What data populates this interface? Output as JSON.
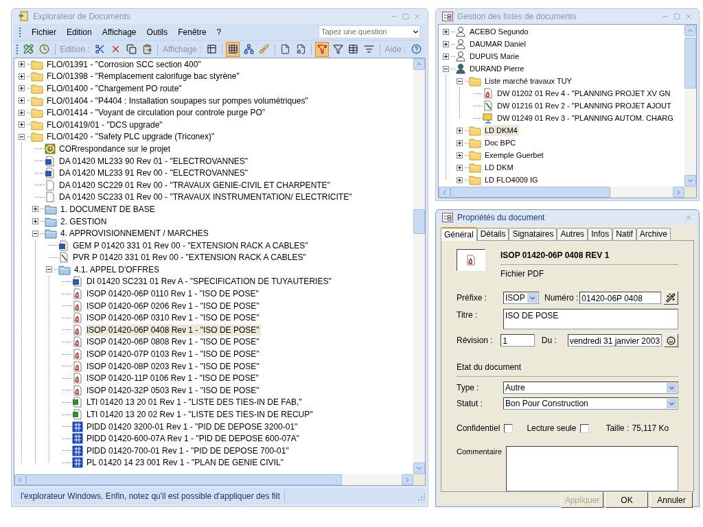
{
  "explorer": {
    "title": "Explorateur de Documents",
    "active": false,
    "menu": [
      {
        "label": "Fichier"
      },
      {
        "label": "Edition"
      },
      {
        "label": "Affichage"
      },
      {
        "label": "Outils"
      },
      {
        "label": "Fenêtre"
      },
      {
        "label": "?"
      }
    ],
    "search": {
      "placeholder": "Tapez une question"
    },
    "toolbar": [
      {
        "kind": "button",
        "pressed": false
      },
      {
        "kind": "button",
        "pressed": false
      },
      {
        "kind": "separator"
      },
      {
        "kind": "label",
        "text": "Edition :"
      },
      {
        "kind": "button",
        "pressed": false
      },
      {
        "kind": "button",
        "pressed": false
      },
      {
        "kind": "button",
        "pressed": false
      },
      {
        "kind": "button",
        "pressed": false
      },
      {
        "kind": "separator"
      },
      {
        "kind": "label",
        "text": "Affichage :"
      },
      {
        "kind": "button",
        "pressed": false
      },
      {
        "kind": "separator"
      },
      {
        "kind": "button",
        "pressed": true
      },
      {
        "kind": "button",
        "pressed": false
      },
      {
        "kind": "button",
        "pressed": false
      },
      {
        "kind": "separator"
      },
      {
        "kind": "button",
        "pressed": false
      },
      {
        "kind": "button",
        "pressed": false
      },
      {
        "kind": "separator"
      },
      {
        "kind": "button",
        "pressed": true
      },
      {
        "kind": "button",
        "pressed": false
      },
      {
        "kind": "button",
        "pressed": false
      },
      {
        "kind": "button",
        "pressed": false
      },
      {
        "kind": "separator"
      },
      {
        "kind": "label",
        "text": "Aide :"
      },
      {
        "kind": "button",
        "pressed": false
      }
    ],
    "tree": [
      {
        "label": "FLO/01391 - \"Corrosion SCC section 400\"",
        "kind": "folder",
        "expanded": false,
        "selected": false
      },
      {
        "label": "FLO/01398 - \"Remplacement calorifuge bac styrène\"",
        "kind": "folder",
        "expanded": false,
        "selected": false
      },
      {
        "label": "FLO/01400 - \"Chargement PO route\"",
        "kind": "folder",
        "expanded": false,
        "selected": false
      },
      {
        "label": "FLO/01404 - \"P4404 : Installation soupapes sur pompes volumétriques\"",
        "kind": "folder",
        "expanded": false,
        "selected": false
      },
      {
        "label": "FLO/01414 - \"Voyant de circulation pour controle purge PO\"",
        "kind": "folder",
        "expanded": false,
        "selected": false
      },
      {
        "label": "FLO/01419/01 - \"DCS upgrade\"",
        "kind": "folder",
        "expanded": false,
        "selected": false
      },
      {
        "label": "FLO/01420 - \"Safety PLC upgrade (Triconex)\"",
        "kind": "folder",
        "expanded": true,
        "selected": false,
        "children": [
          {
            "label": "CORrespondance sur le projet",
            "kind": "cor",
            "selected": false
          },
          {
            "label": "DA 01420 ML233 90 Rev 01 - \"ELECTROVANNES\"",
            "kind": "word",
            "selected": false
          },
          {
            "label": "DA 01420 ML233 91 Rev 00 - \"ELECTROVANNES\"",
            "kind": "word",
            "selected": false
          },
          {
            "label": "DA 01420 SC229 01 Rev 00 - \"TRAVAUX GENIE-CIVIL ET CHARPENTE\"",
            "kind": "file",
            "selected": false
          },
          {
            "label": "DA 01420 SC233 01 Rev 00 - \"TRAVAUX INSTRUMENTATION/ ELECTRICITE\"",
            "kind": "file",
            "selected": false
          },
          {
            "label": "1. DOCUMENT DE BASE",
            "kind": "folder-blue",
            "expanded": false,
            "selected": false
          },
          {
            "label": "2. GESTION",
            "kind": "folder-blue",
            "expanded": false,
            "selected": false
          },
          {
            "label": "4. APPROVISIONNEMENT / MARCHES",
            "kind": "folder-blue",
            "expanded": true,
            "selected": false,
            "children": [
              {
                "label": "GEM P 01420 331 01 Rev 00 - \"EXTENSION RACK A CABLES\"",
                "kind": "word",
                "selected": false
              },
              {
                "label": "PVR P 01420 331 01 Rev 00 - \"EXTENSION RACK A CABLES\"",
                "kind": "pvr",
                "selected": false
              },
              {
                "label": "4.1. APPEL D'OFFRES",
                "kind": "folder-blue",
                "expanded": true,
                "selected": false,
                "children": [
                  {
                    "label": "DI 01420 SC231 01 Rev A - \"SPECIFICATION DE TUYAUTERIES\"",
                    "kind": "word",
                    "selected": false
                  },
                  {
                    "label": "ISOP 01420-06P 0110 Rev 1 - \"ISO DE POSE\"",
                    "kind": "pdf",
                    "selected": false
                  },
                  {
                    "label": "ISOP 01420-06P 0206 Rev 1 - \"ISO DE POSE\"",
                    "kind": "pdf",
                    "selected": false
                  },
                  {
                    "label": "ISOP 01420-06P 0310 Rev 1 - \"ISO DE POSE\"",
                    "kind": "pdf",
                    "selected": false
                  },
                  {
                    "label": "ISOP 01420-06P 0408 Rev 1 - \"ISO DE POSE\"",
                    "kind": "pdf",
                    "selected": true
                  },
                  {
                    "label": "ISOP 01420-06P 0808 Rev 1 - \"ISO DE POSE\"",
                    "kind": "pdf",
                    "selected": false
                  },
                  {
                    "label": "ISOP 01420-07P 0103 Rev 1 - \"ISO DE POSE\"",
                    "kind": "pdf",
                    "selected": false
                  },
                  {
                    "label": "ISOP 01420-08P 0203 Rev 1 - \"ISO DE POSE\"",
                    "kind": "pdf",
                    "selected": false
                  },
                  {
                    "label": "ISOP 01420-11P 0106 Rev 1 - \"ISO DE POSE\"",
                    "kind": "pdf",
                    "selected": false
                  },
                  {
                    "label": "ISOP 01420-32P 0503 Rev 1 - \"ISO DE POSE\"",
                    "kind": "pdf",
                    "selected": false
                  },
                  {
                    "label": "LTI 01420 13 20 01 Rev 1 - \"LISTE DES TIES-IN DE FAB,\"",
                    "kind": "excel",
                    "selected": false
                  },
                  {
                    "label": "LTI 01420 13 20 02 Rev 1 - \"LISTE DES TIES-IN DE RECUP\"",
                    "kind": "excel",
                    "selected": false
                  },
                  {
                    "label": "PIDD 01420 3200-01 Rev 1 - \"PID DE DEPOSE 3200-01\"",
                    "kind": "pid",
                    "selected": false
                  },
                  {
                    "label": "PIDD 01420-600-07A Rev 1 - \"PID DE DEPOSE 600-07A\"",
                    "kind": "pid",
                    "selected": false
                  },
                  {
                    "label": "PIDD 01420-700-01 Rev 1 - \"PID DE DEPOSE 700-01\"",
                    "kind": "pid",
                    "selected": false
                  },
                  {
                    "label": "PL 01420 14 23 001 Rev 1 - \"PLAN DE GENIE CIVIL\"",
                    "kind": "pid",
                    "selected": false
                  }
                ]
              }
            ]
          }
        ]
      }
    ],
    "status_bar": "l'explorateur Windows. Enfin, notez qu'il est possible d'appliquer des filt"
  },
  "lists": {
    "title": "Gestion des listes de documents",
    "active": false,
    "tree": [
      {
        "label": "ACEBO Segundo",
        "kind": "person",
        "expanded": false,
        "selected": false
      },
      {
        "label": "DAUMAR Daniel",
        "kind": "person",
        "expanded": false,
        "selected": false
      },
      {
        "label": "DUPUIS Marie",
        "kind": "person",
        "expanded": false,
        "selected": false
      },
      {
        "label": "DURAND Pierre",
        "kind": "person-current",
        "expanded": true,
        "selected": false,
        "children": [
          {
            "label": "Liste marché travaux TUY",
            "kind": "folder",
            "expanded": true,
            "selected": false,
            "children": [
              {
                "label": "DW 01202 01 Rev 4 - \"PLANNING PROJET XV GN",
                "kind": "pdf",
                "selected": false
              },
              {
                "label": "DW 01216 01 Rev 2 - \"PLANNING PROJET AJOUT",
                "kind": "pvr",
                "selected": false
              },
              {
                "label": "DW 01249 01 Rev 3 - \"PLANNING AUTOM. CHARG",
                "kind": "project",
                "selected": false
              }
            ]
          },
          {
            "label": "LD DKM4",
            "kind": "folder",
            "expanded": false,
            "selected": true
          },
          {
            "label": "Doc BPC",
            "kind": "folder",
            "expanded": false,
            "selected": false
          },
          {
            "label": "Exemple Guerbet",
            "kind": "folder",
            "expanded": false,
            "selected": false
          },
          {
            "label": "LD DKM",
            "kind": "folder",
            "expanded": false,
            "selected": false
          },
          {
            "label": "LD FLO4009 IG",
            "kind": "folder",
            "expanded": false,
            "selected": false
          }
        ]
      }
    ]
  },
  "properties": {
    "title": "Propriétés du document",
    "active": true,
    "tabs": [
      {
        "label": "Général",
        "selected": true
      },
      {
        "label": "Détails",
        "selected": false
      },
      {
        "label": "Signataires",
        "selected": false
      },
      {
        "label": "Autres",
        "selected": false
      },
      {
        "label": "Infos",
        "selected": false
      },
      {
        "label": "Natif",
        "selected": false
      },
      {
        "label": "Archive",
        "selected": false
      }
    ],
    "document": {
      "name": "ISOP 01420-06P 0408 REV 1",
      "file_type": "Fichier PDF"
    },
    "prefix": {
      "label": "Préfixe :",
      "value": "ISOP"
    },
    "number": {
      "label": "Numéro :",
      "value": "01420-06P 0408"
    },
    "doc_title": {
      "label": "Titre :",
      "value": "ISO DE POSE"
    },
    "revision": {
      "label": "Révision :",
      "value": "1"
    },
    "date": {
      "label": "Du :",
      "value": "vendredi 31 janvier 2003"
    },
    "state_heading": "Etat du document",
    "type": {
      "label": "Type :",
      "value": "Autre"
    },
    "status": {
      "label": "Statut :",
      "value": "Bon Pour Construction"
    },
    "confidential": {
      "label": "Confidentiel",
      "checked": false
    },
    "read_only": {
      "label": "Lecture seule",
      "checked": false
    },
    "size": {
      "label": "Taille :",
      "value": "75,117 Ko"
    },
    "comment": {
      "label": "Commentaire"
    },
    "buttons": [
      {
        "label": "Appliquer",
        "disabled": true
      },
      {
        "label": "OK",
        "disabled": false
      },
      {
        "label": "Annuler",
        "disabled": false
      }
    ]
  }
}
